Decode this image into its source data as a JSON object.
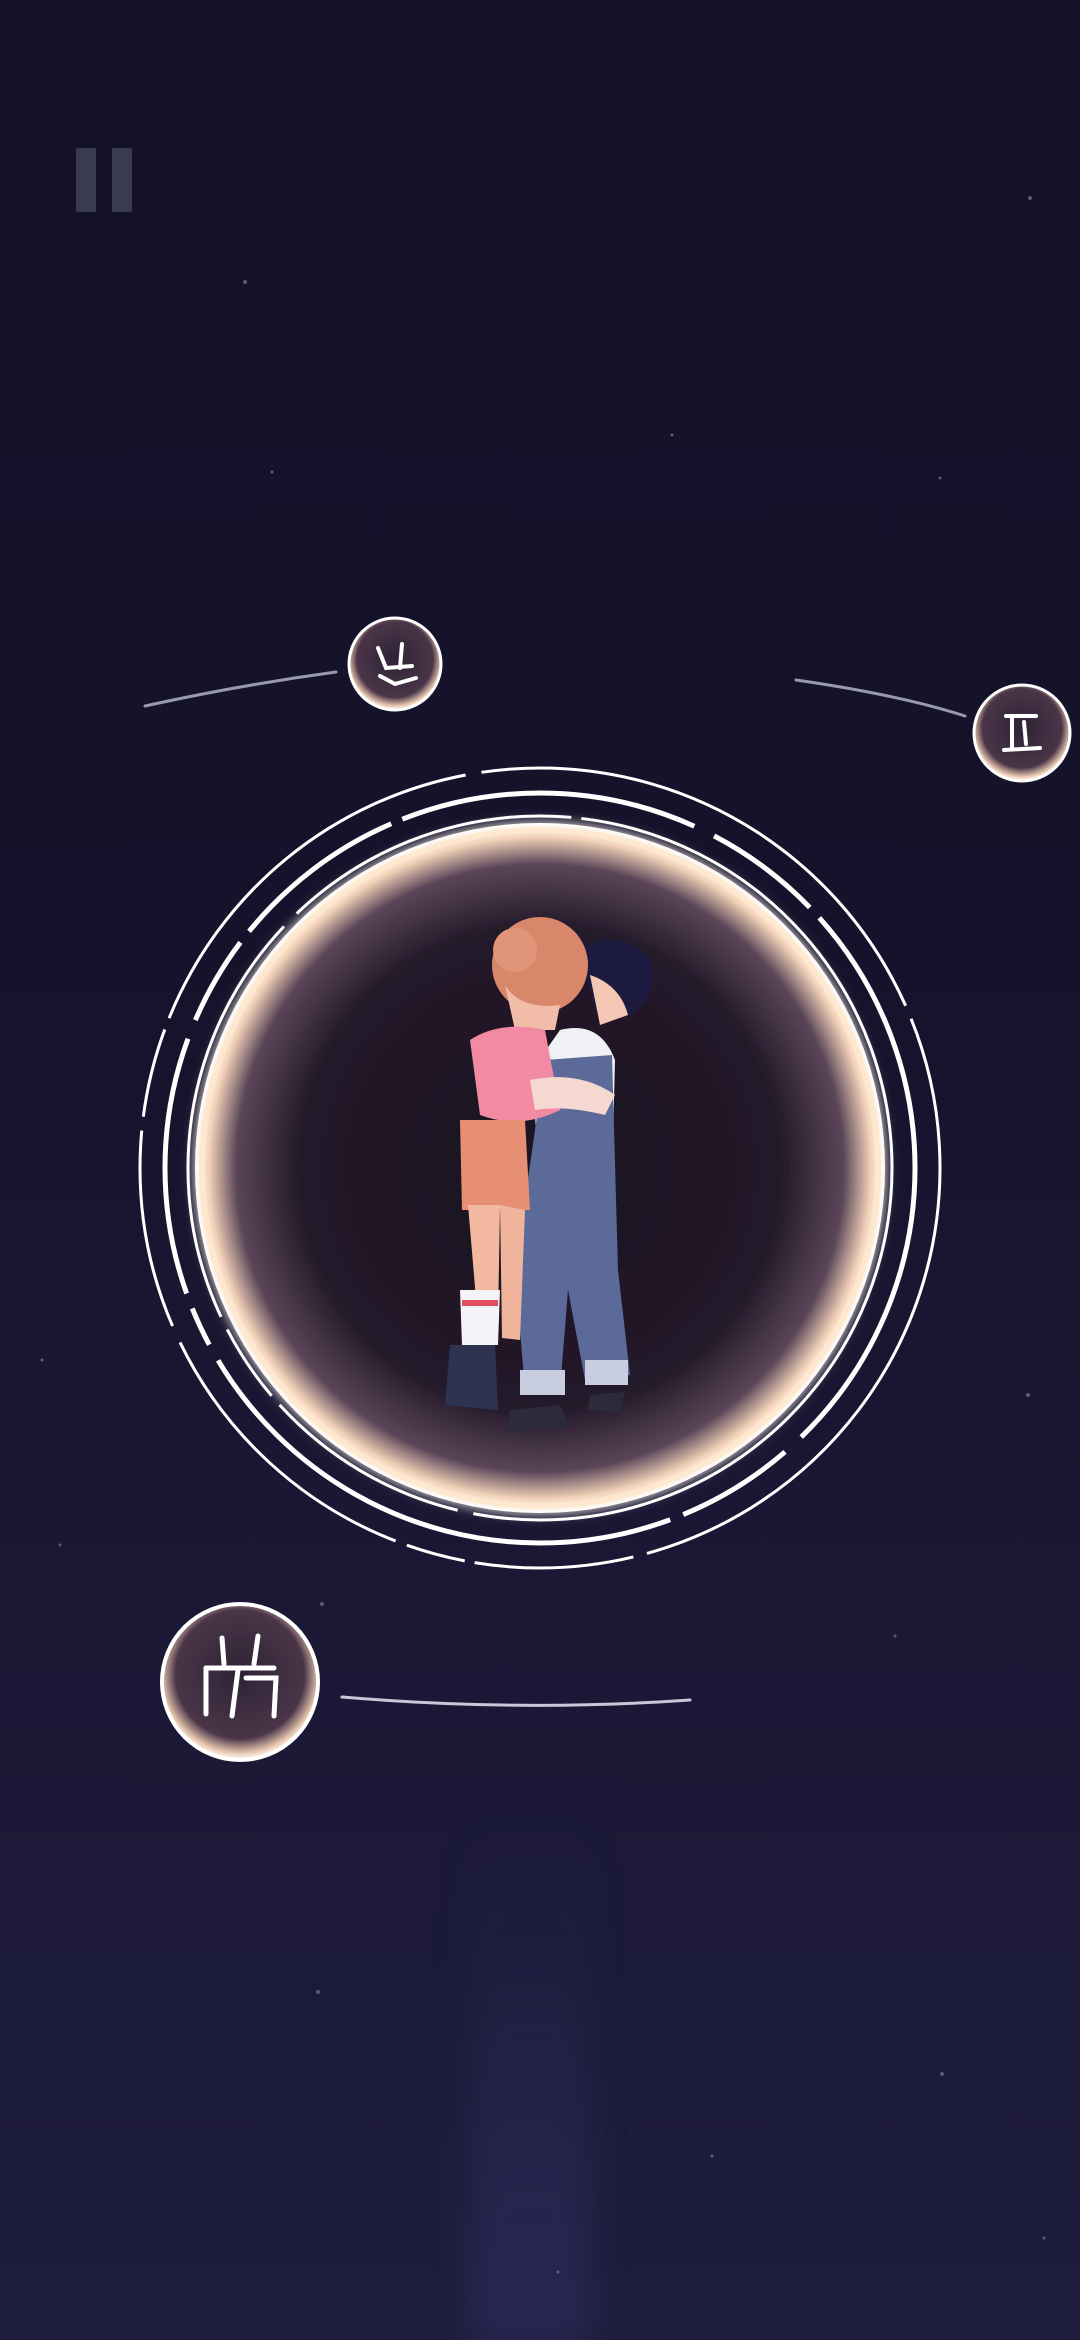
{
  "game": {
    "controls": {
      "pause": {
        "icon": "pause-icon"
      }
    },
    "scene": {
      "portal": {
        "icon": "glowing-portal-ring"
      },
      "characters": {
        "icon": "hugging-couple"
      },
      "rune_nodes": [
        {
          "name": "rune-node-top-left",
          "icon": "rune-glyph-icon"
        },
        {
          "name": "rune-node-top-right",
          "icon": "rune-glyph-icon"
        },
        {
          "name": "rune-node-bottom-left",
          "icon": "rune-glyph-icon"
        }
      ]
    },
    "colors": {
      "background_top": "#141228",
      "background_bottom": "#1f1d3d",
      "ring": "#ffffff",
      "portal_glow": "#ffd9b0",
      "node_fill": "#3b2f42"
    }
  }
}
